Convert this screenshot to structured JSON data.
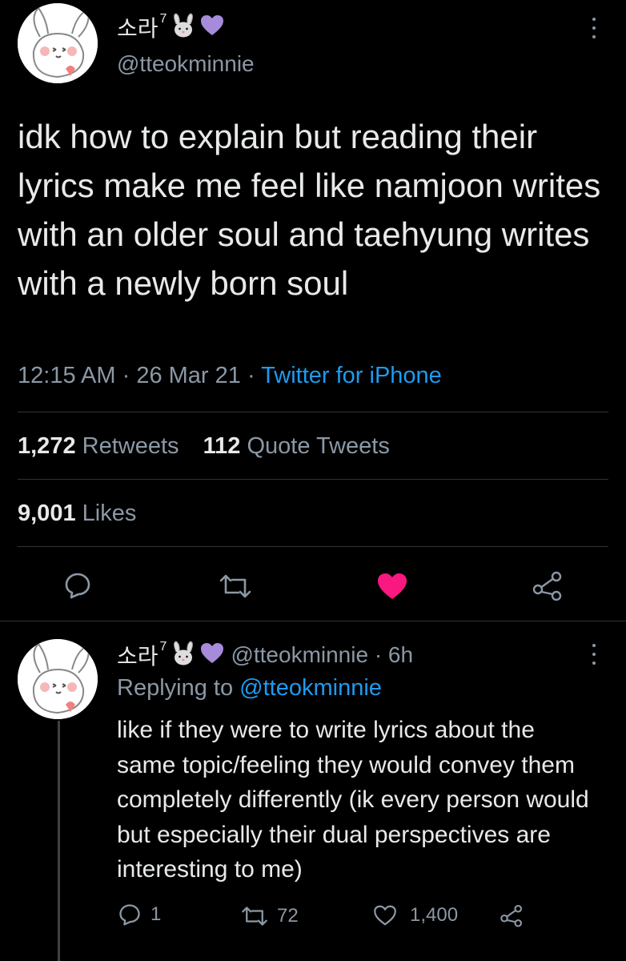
{
  "tweet": {
    "display_name": "소라",
    "name_superscript": "7",
    "name_emojis": [
      "rabbit-face-icon",
      "purple-heart-icon"
    ],
    "handle": "@tteokminnie",
    "text": "idk how to explain but reading their lyrics make me feel like namjoon writes with an older soul and taehyung writes with a newly born soul",
    "time": "12:15 AM",
    "date": "26 Mar 21",
    "source": "Twitter for iPhone",
    "retweets_count": "1,272",
    "retweets_label": "Retweets",
    "quote_count": "112",
    "quote_label": "Quote Tweets",
    "likes_count": "9,001",
    "likes_label": "Likes",
    "liked": true,
    "colors": {
      "like": "#f91880",
      "link": "#1d9bf0",
      "muted": "#8b98a5",
      "heart_emoji": "#a78bdb"
    }
  },
  "reply": {
    "display_name": "소라",
    "name_superscript": "7",
    "handle_time": "@tteokminnie · 6h",
    "replying_to_label": "Replying to",
    "replying_to_mention": "@tteokminnie",
    "text": "like if they were to write lyrics about the same topic/feeling they would convey them completely differently (ik every person would but especially their dual perspectives are interesting to me)",
    "reply_count": "1",
    "retweet_count": "72",
    "like_count": "1,400"
  }
}
